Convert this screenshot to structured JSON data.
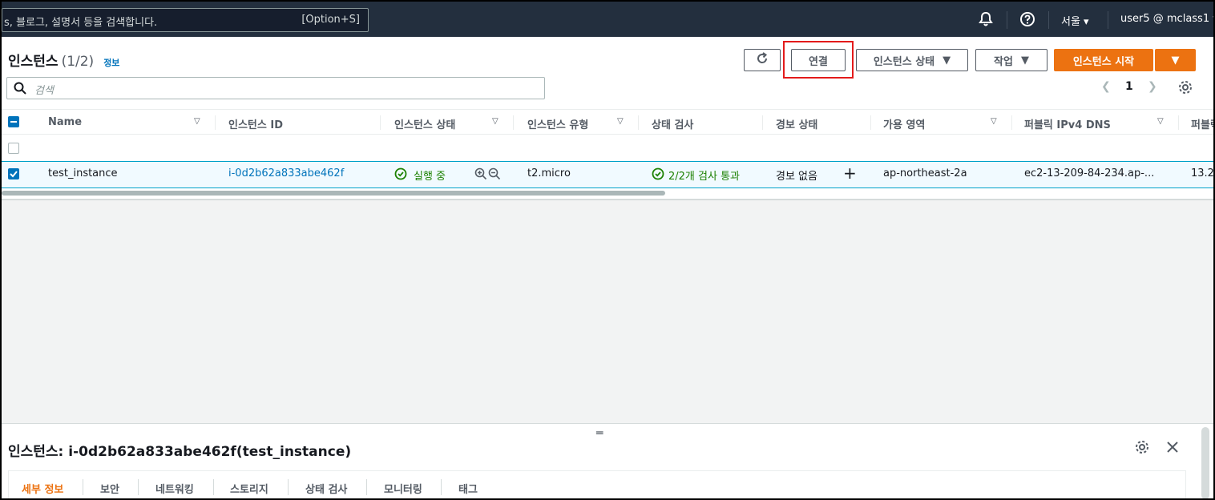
{
  "topnav": {
    "search_placeholder": "s, 블로그, 설명서 등을 검색합니다.",
    "search_shortcut": "[Option+S]",
    "region": "서울 ▾",
    "account": "user5 @ mclass1 ▾"
  },
  "header": {
    "title": "인스턴스",
    "count": "(1/2)",
    "info_link": "정보",
    "connect_label": "연결",
    "instance_state_label": "인스턴스 상태",
    "actions_label": "작업",
    "launch_label": "인스턴스 시작"
  },
  "filter": {
    "placeholder": "검색"
  },
  "pagination": {
    "page": "1"
  },
  "table": {
    "columns": [
      "Name",
      "인스턴스 ID",
      "인스턴스 상태",
      "인스턴스 유형",
      "상태 검사",
      "경보 상태",
      "가용 영역",
      "퍼블릭 IPv4 DNS",
      "퍼블릭"
    ],
    "rows": [
      {
        "name": "test_instance",
        "instance_id": "i-0d2b62a833abe462f",
        "state": "실행 중",
        "type": "t2.micro",
        "status_check": "2/2개 검사 통과",
        "alarm": "경보 없음",
        "az": "ap-northeast-2a",
        "dns": "ec2-13-209-84-234.ap-...",
        "ip": "13.2"
      }
    ]
  },
  "details": {
    "title": "인스턴스: i-0d2b62a833abe462f(test_instance)",
    "tabs": [
      "세부 정보",
      "보안",
      "네트워킹",
      "스토리지",
      "상태 검사",
      "모니터링",
      "태그"
    ]
  },
  "colors": {
    "accent": "#ec7211",
    "link": "#0073bb",
    "success": "#1d8102",
    "highlight": "#e31b1b"
  }
}
